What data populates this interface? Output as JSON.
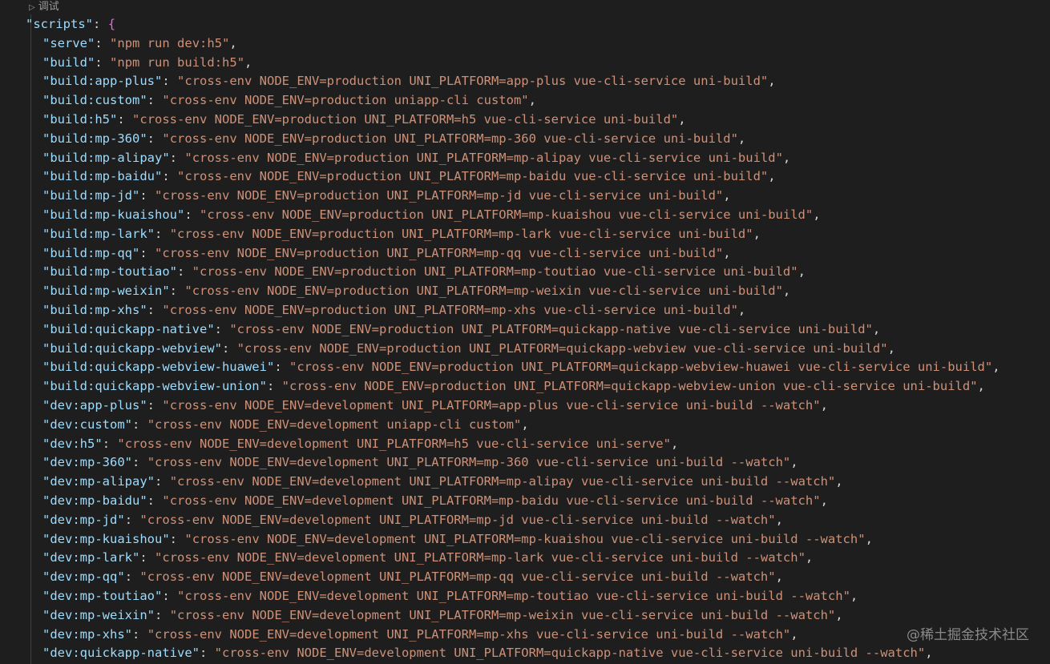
{
  "codelens": {
    "icon": "play-triangle-icon",
    "label": "调试"
  },
  "object_key": "scripts",
  "open_brace": "{",
  "entries": [
    {
      "key": "serve",
      "value": "npm run dev:h5"
    },
    {
      "key": "build",
      "value": "npm run build:h5"
    },
    {
      "key": "build:app-plus",
      "value": "cross-env NODE_ENV=production UNI_PLATFORM=app-plus vue-cli-service uni-build"
    },
    {
      "key": "build:custom",
      "value": "cross-env NODE_ENV=production uniapp-cli custom"
    },
    {
      "key": "build:h5",
      "value": "cross-env NODE_ENV=production UNI_PLATFORM=h5 vue-cli-service uni-build"
    },
    {
      "key": "build:mp-360",
      "value": "cross-env NODE_ENV=production UNI_PLATFORM=mp-360 vue-cli-service uni-build"
    },
    {
      "key": "build:mp-alipay",
      "value": "cross-env NODE_ENV=production UNI_PLATFORM=mp-alipay vue-cli-service uni-build"
    },
    {
      "key": "build:mp-baidu",
      "value": "cross-env NODE_ENV=production UNI_PLATFORM=mp-baidu vue-cli-service uni-build"
    },
    {
      "key": "build:mp-jd",
      "value": "cross-env NODE_ENV=production UNI_PLATFORM=mp-jd vue-cli-service uni-build"
    },
    {
      "key": "build:mp-kuaishou",
      "value": "cross-env NODE_ENV=production UNI_PLATFORM=mp-kuaishou vue-cli-service uni-build"
    },
    {
      "key": "build:mp-lark",
      "value": "cross-env NODE_ENV=production UNI_PLATFORM=mp-lark vue-cli-service uni-build"
    },
    {
      "key": "build:mp-qq",
      "value": "cross-env NODE_ENV=production UNI_PLATFORM=mp-qq vue-cli-service uni-build"
    },
    {
      "key": "build:mp-toutiao",
      "value": "cross-env NODE_ENV=production UNI_PLATFORM=mp-toutiao vue-cli-service uni-build"
    },
    {
      "key": "build:mp-weixin",
      "value": "cross-env NODE_ENV=production UNI_PLATFORM=mp-weixin vue-cli-service uni-build"
    },
    {
      "key": "build:mp-xhs",
      "value": "cross-env NODE_ENV=production UNI_PLATFORM=mp-xhs vue-cli-service uni-build"
    },
    {
      "key": "build:quickapp-native",
      "value": "cross-env NODE_ENV=production UNI_PLATFORM=quickapp-native vue-cli-service uni-build"
    },
    {
      "key": "build:quickapp-webview",
      "value": "cross-env NODE_ENV=production UNI_PLATFORM=quickapp-webview vue-cli-service uni-build"
    },
    {
      "key": "build:quickapp-webview-huawei",
      "value": "cross-env NODE_ENV=production UNI_PLATFORM=quickapp-webview-huawei vue-cli-service uni-build"
    },
    {
      "key": "build:quickapp-webview-union",
      "value": "cross-env NODE_ENV=production UNI_PLATFORM=quickapp-webview-union vue-cli-service uni-build"
    },
    {
      "key": "dev:app-plus",
      "value": "cross-env NODE_ENV=development UNI_PLATFORM=app-plus vue-cli-service uni-build --watch"
    },
    {
      "key": "dev:custom",
      "value": "cross-env NODE_ENV=development uniapp-cli custom"
    },
    {
      "key": "dev:h5",
      "value": "cross-env NODE_ENV=development UNI_PLATFORM=h5 vue-cli-service uni-serve"
    },
    {
      "key": "dev:mp-360",
      "value": "cross-env NODE_ENV=development UNI_PLATFORM=mp-360 vue-cli-service uni-build --watch"
    },
    {
      "key": "dev:mp-alipay",
      "value": "cross-env NODE_ENV=development UNI_PLATFORM=mp-alipay vue-cli-service uni-build --watch"
    },
    {
      "key": "dev:mp-baidu",
      "value": "cross-env NODE_ENV=development UNI_PLATFORM=mp-baidu vue-cli-service uni-build --watch"
    },
    {
      "key": "dev:mp-jd",
      "value": "cross-env NODE_ENV=development UNI_PLATFORM=mp-jd vue-cli-service uni-build --watch"
    },
    {
      "key": "dev:mp-kuaishou",
      "value": "cross-env NODE_ENV=development UNI_PLATFORM=mp-kuaishou vue-cli-service uni-build --watch"
    },
    {
      "key": "dev:mp-lark",
      "value": "cross-env NODE_ENV=development UNI_PLATFORM=mp-lark vue-cli-service uni-build --watch"
    },
    {
      "key": "dev:mp-qq",
      "value": "cross-env NODE_ENV=development UNI_PLATFORM=mp-qq vue-cli-service uni-build --watch"
    },
    {
      "key": "dev:mp-toutiao",
      "value": "cross-env NODE_ENV=development UNI_PLATFORM=mp-toutiao vue-cli-service uni-build --watch"
    },
    {
      "key": "dev:mp-weixin",
      "value": "cross-env NODE_ENV=development UNI_PLATFORM=mp-weixin vue-cli-service uni-build --watch"
    },
    {
      "key": "dev:mp-xhs",
      "value": "cross-env NODE_ENV=development UNI_PLATFORM=mp-xhs vue-cli-service uni-build --watch"
    },
    {
      "key": "dev:quickapp-native",
      "value": "cross-env NODE_ENV=development UNI_PLATFORM=quickapp-native vue-cli-service uni-build --watch"
    }
  ],
  "watermark": "@稀土掘金技术社区",
  "colors": {
    "background": "#1e1e1e",
    "key": "#9cdcfe",
    "string": "#ce9178",
    "punctuation": "#d4d4d4",
    "brace": "#da70d6",
    "codelens": "#999999"
  }
}
